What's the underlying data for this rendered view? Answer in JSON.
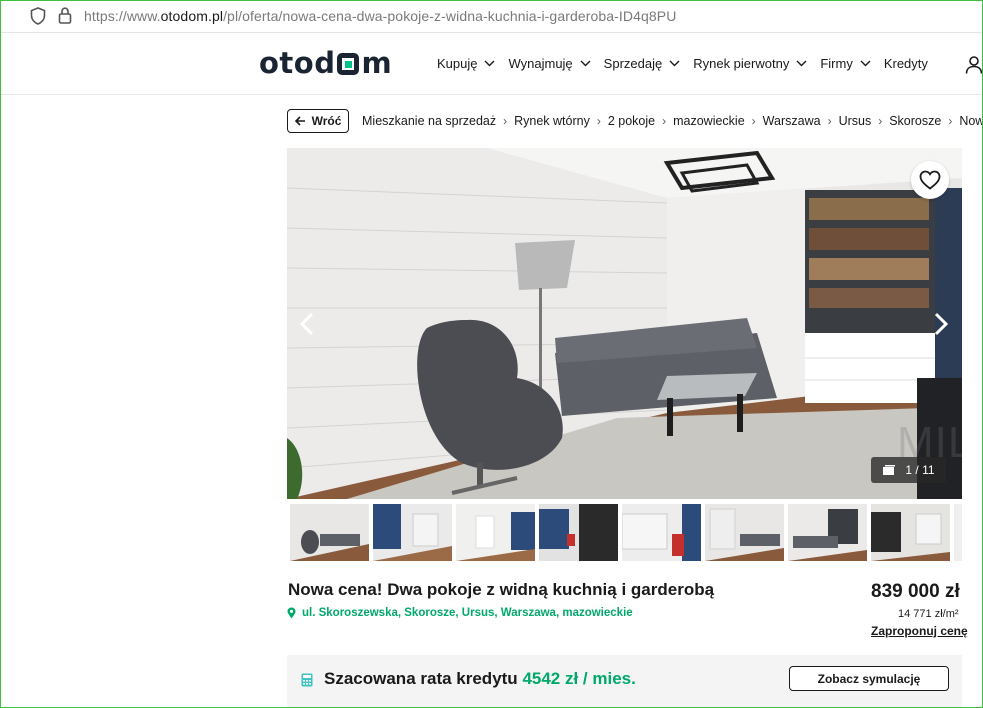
{
  "browser": {
    "url_prefix": "https://www.",
    "url_host": "otodom.pl",
    "url_path": "/pl/oferta/nowa-cena-dwa-pokoje-z-widna-kuchnia-i-garderoba-ID4q8PU"
  },
  "header": {
    "logo_left": "otod",
    "logo_right": "m",
    "nav": [
      "Kupuję",
      "Wynajmuję",
      "Sprzedaję",
      "Rynek pierwotny",
      "Firmy",
      "Kredyty"
    ]
  },
  "breadcrumb": {
    "back_label": "Wróć",
    "items": [
      "Mieszkanie na sprzedaż",
      "Rynek wtórny",
      "2 pokoje",
      "mazowieckie",
      "Warszawa",
      "Ursus",
      "Skorosze",
      "Nowa cena!"
    ]
  },
  "gallery": {
    "counter": "1 / 11",
    "watermark": "MILTON"
  },
  "listing": {
    "title": "Nowa cena! Dwa pokoje z widną kuchnią i garderobą",
    "location": "ul. Skoroszewska, Skorosze, Ursus, Warszawa, mazowieckie",
    "price": "839 000 zł",
    "price_per_m2": "14 771 zł/m²",
    "propose_price": "Zaproponuj cenę"
  },
  "credit": {
    "label": "Szacowana rata kredytu",
    "value": "4542 zł / mies.",
    "simulate_button": "Zobacz symulację"
  },
  "colors": {
    "accent_green": "#00a86b",
    "dark": "#1b2433"
  }
}
